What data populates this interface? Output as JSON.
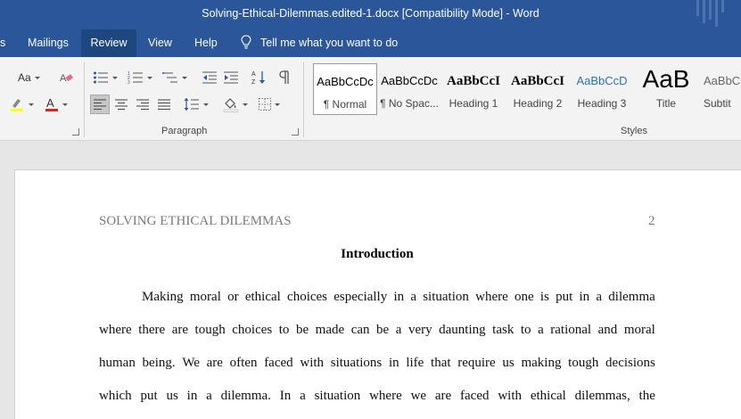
{
  "window": {
    "title": "Solving-Ethical-Dilemmas.edited-1.docx [Compatibility Mode]  -  Word"
  },
  "tabs": [
    {
      "label": "s"
    },
    {
      "label": "Mailings"
    },
    {
      "label": "Review"
    },
    {
      "label": "View"
    },
    {
      "label": "Help"
    }
  ],
  "tellme": {
    "label": "Tell me what you want to do"
  },
  "ribbon": {
    "font_size_label": "Aa",
    "paragraph_label": "Paragraph",
    "styles_label": "Styles",
    "styles": [
      {
        "sample": "AaBbCcDc",
        "name": "¶ Normal"
      },
      {
        "sample": "AaBbCcDc",
        "name": "¶ No Spac..."
      },
      {
        "sample": "AaBbCcI",
        "name": "Heading 1"
      },
      {
        "sample": "AaBbCcI",
        "name": "Heading 2"
      },
      {
        "sample": "AaBbCcD",
        "name": "Heading 3"
      },
      {
        "sample": "AaB",
        "name": "Title"
      },
      {
        "sample": "AaBbC",
        "name": "Subtit"
      }
    ]
  },
  "document": {
    "running_header": "SOLVING ETHICAL DILEMMAS",
    "page_number": "2",
    "heading": "Introduction",
    "lines": [
      "Making moral or ethical choices especially in a situation where one is put in a dilemma",
      "where there are tough choices to be made can be a very daunting task to a rational and moral",
      "human being. We are often faced with situations in life that require us making tough decisions",
      "which put us in a dilemma. In a situation where we are faced with ethical dilemmas, the"
    ]
  },
  "colors": {
    "title_bar": "#2b579a",
    "active_tab": "#1e477f",
    "ribbon_bg": "#f3f3f3",
    "heading_style": "#2e74b5"
  }
}
